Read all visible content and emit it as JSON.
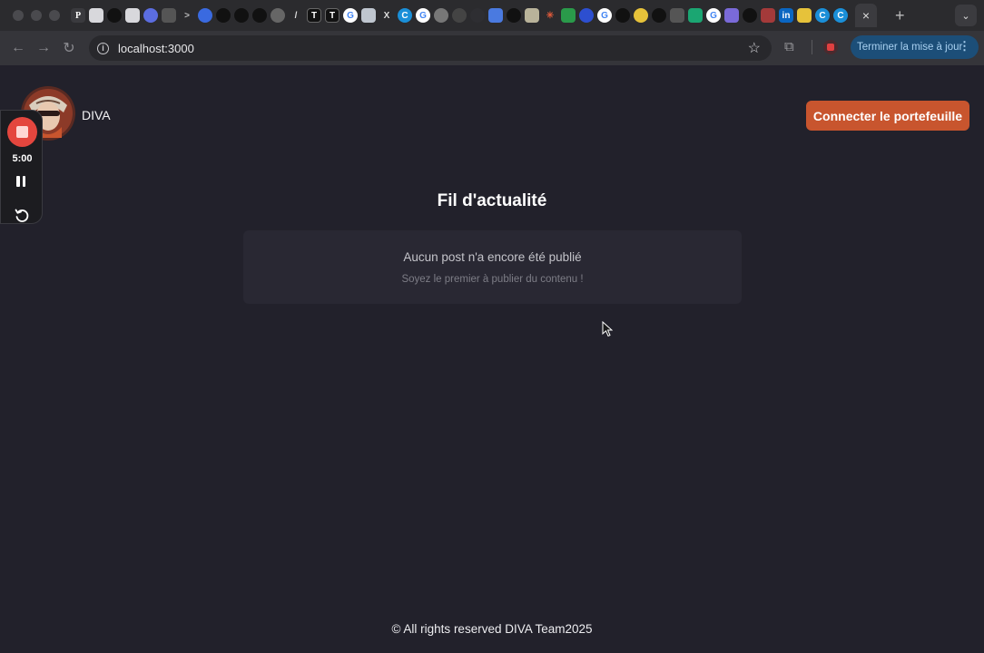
{
  "browser": {
    "url": "localhost:3000",
    "update_label": "Terminer la mise à jour",
    "tab_close": "×",
    "new_tab": "+"
  },
  "header": {
    "brand": "DIVA",
    "connect_label": "Connecter le portefeuille"
  },
  "feed": {
    "title": "Fil d'actualité",
    "empty_title": "Aucun post n'a encore été publié",
    "empty_subtitle": "Soyez le premier à publier du contenu !"
  },
  "recorder": {
    "timer": "5:00"
  },
  "footer": {
    "text": "© All rights reserved DIVA Team2025"
  },
  "colors": {
    "page_bg": "#22212b",
    "card_bg": "#292833",
    "accent": "#c8552e",
    "record": "#e4463e"
  }
}
